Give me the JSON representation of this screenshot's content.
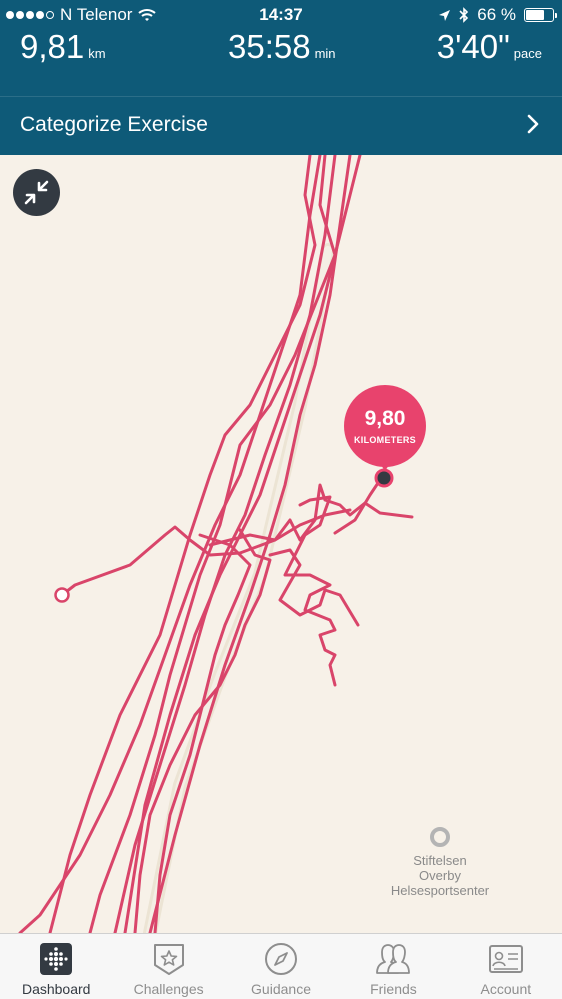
{
  "status_bar": {
    "carrier": "N Telenor",
    "time": "14:37",
    "battery_percent": "66 %",
    "battery_level": 0.66,
    "signal_bars_filled": 4,
    "icons": [
      "wifi-icon",
      "location-arrow-icon",
      "bluetooth-icon",
      "battery-icon"
    ]
  },
  "stats": [
    {
      "value": "9,81",
      "unit": "km"
    },
    {
      "value": "35:58",
      "unit": "min"
    },
    {
      "value": "3'40\"",
      "unit": "pace"
    }
  ],
  "category_row": {
    "label": "Categorize Exercise",
    "icon": "chevron-right-icon"
  },
  "map": {
    "collapse_icon": "collapse-arrows-icon",
    "distance_marker": {
      "value": "9,80",
      "unit": "KILOMETERS"
    },
    "poi": {
      "line1": "Stiftelsen",
      "line2": "Overby",
      "line3": "Helsesportsenter",
      "icon": "poi-circle-icon"
    },
    "route_color": "#d9456a",
    "land_color": "#f7f1e8"
  },
  "tabs": [
    {
      "label": "Dashboard",
      "icon": "dashboard-icon",
      "active": true
    },
    {
      "label": "Challenges",
      "icon": "challenges-star-icon",
      "active": false
    },
    {
      "label": "Guidance",
      "icon": "compass-icon",
      "active": false
    },
    {
      "label": "Friends",
      "icon": "friends-icon",
      "active": false
    },
    {
      "label": "Account",
      "icon": "account-card-icon",
      "active": false
    }
  ],
  "colors": {
    "header": "#0e5a78",
    "accent": "#e8436d",
    "tab_active": "#333a42",
    "tab_inactive": "#8e8e8e"
  }
}
